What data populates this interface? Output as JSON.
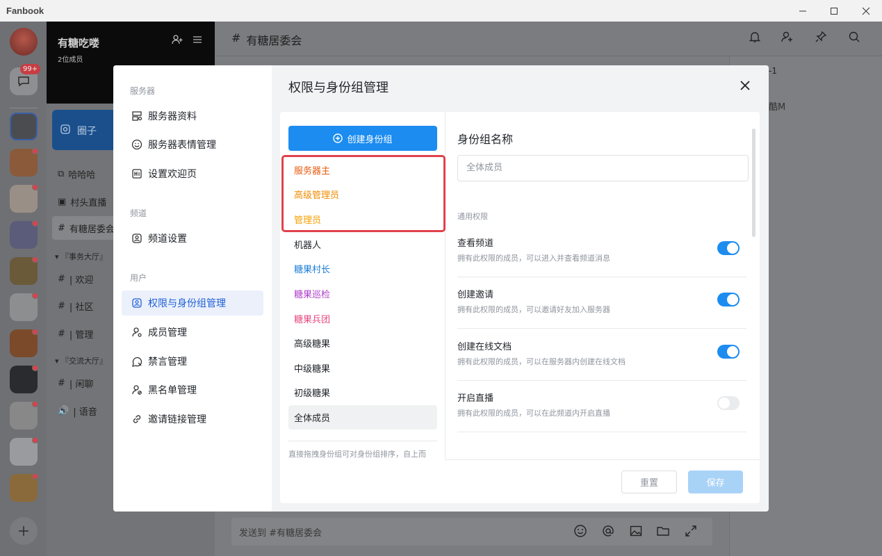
{
  "app": {
    "name": "Fanbook"
  },
  "window_controls": {
    "minimize": "—",
    "maximize": "☐",
    "close": "✕"
  },
  "rail": {
    "unread_badge": "99+"
  },
  "server": {
    "name": "有糖吃喽",
    "member_count": "2位成员"
  },
  "channel_sidebar": {
    "circle_label": "圈子",
    "channels": [
      {
        "icon": "link-icon",
        "name": "哈哈哈"
      },
      {
        "icon": "live-icon",
        "name": "村头直播"
      },
      {
        "icon": "hash-icon",
        "name": "有糖居委会"
      }
    ],
    "categories": [
      "『事务大厅』",
      "『交流大厅』"
    ],
    "category1_channels": [
      {
        "prefix": "#",
        "name": "| 欢迎"
      },
      {
        "prefix": "#",
        "name": "| 社区"
      },
      {
        "prefix": "#",
        "name": "| 管理"
      }
    ],
    "category2_channels": [
      {
        "prefix": "#",
        "name": "| 闲聊"
      },
      {
        "prefix": "🔊",
        "name": "| 语音"
      }
    ]
  },
  "main": {
    "channel_title": "有糖居委会",
    "composer_placeholder": "发送到 #有糖居委会",
    "right_panel": {
      "line1": "-1",
      "line2": "酷M"
    }
  },
  "modal": {
    "title": "权限与身份组管理",
    "nav": {
      "cat_server": "服务器",
      "server_profile": "服务器资料",
      "emoji_mgmt": "服务器表情管理",
      "welcome_page": "设置欢迎页",
      "cat_channel": "频道",
      "channel_settings": "频道设置",
      "cat_user": "用户",
      "roles_perms": "权限与身份组管理",
      "members": "成员管理",
      "mute": "禁言管理",
      "blacklist": "黑名单管理",
      "invite_links": "邀请链接管理"
    },
    "create_role_label": "创建身份组",
    "roles": [
      {
        "name": "服务器主",
        "color": "#e8590c"
      },
      {
        "name": "高级管理员",
        "color": "#f08c00"
      },
      {
        "name": "管理员",
        "color": "#f59f00"
      },
      {
        "name": "机器人",
        "color": "#1f2329"
      },
      {
        "name": "糖果村长",
        "color": "#1c7ed6"
      },
      {
        "name": "糖果巡检",
        "color": "#ae3ec9"
      },
      {
        "name": "糖果兵团",
        "color": "#e64980"
      },
      {
        "name": "高级糖果",
        "color": "#1f2329"
      },
      {
        "name": "中级糖果",
        "color": "#1f2329"
      },
      {
        "name": "初级糖果",
        "color": "#1f2329"
      },
      {
        "name": "全体成员",
        "color": "#1f2329"
      }
    ],
    "roles_hint": "直接拖拽身份组可对身份组排序，自上而",
    "role_name_label": "身份组名称",
    "role_name_value": "全体成员",
    "perm_category": "通用权限",
    "permissions": [
      {
        "name": "查看频道",
        "desc": "拥有此权限的成员，可以进入并查看频道消息",
        "enabled": true
      },
      {
        "name": "创建邀请",
        "desc": "拥有此权限的成员，可以邀请好友加入服务器",
        "enabled": true
      },
      {
        "name": "创建在线文档",
        "desc": "拥有此权限的成员，可以在服务器内创建在线文档",
        "enabled": true
      },
      {
        "name": "开启直播",
        "desc": "拥有此权限的成员，可以在此频道内开启直播",
        "enabled": false
      }
    ],
    "reset_label": "重置",
    "save_label": "保存"
  }
}
